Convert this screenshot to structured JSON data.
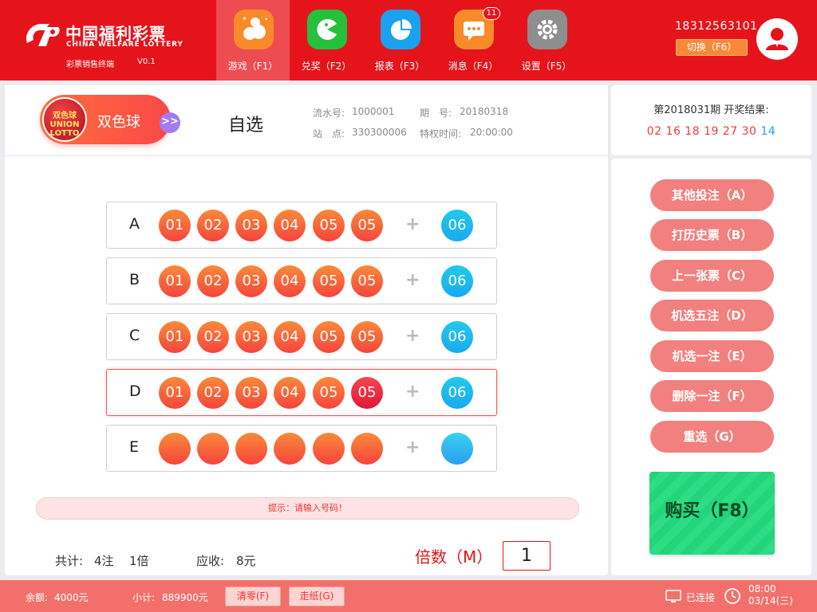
{
  "header": {
    "logo_cn": "中国福利彩票",
    "logo_en": "CHINA WELFARE LOTTERY",
    "subtitle": "彩票销售终端",
    "version": "V0.1",
    "nav": [
      {
        "label": "游戏（F1）",
        "icon": "game-icon",
        "color": "#f88a2a"
      },
      {
        "label": "兑奖（F2）",
        "icon": "prize-icon",
        "color": "#25c03c"
      },
      {
        "label": "报表（F3）",
        "icon": "report-icon",
        "color": "#1aa2ef"
      },
      {
        "label": "消息（F4）",
        "icon": "message-icon",
        "color": "#f88a2a",
        "badge": "11"
      },
      {
        "label": "设置（F5）",
        "icon": "settings-icon",
        "color": "#8e8e8e"
      }
    ],
    "user_phone": "18312563101",
    "switch_label": "切换（F6）"
  },
  "game": {
    "name": "双色球",
    "logo_text": "双色球 UNION LOTTO",
    "arrow": ">>",
    "mode": "自选",
    "serial_label": "流水号:",
    "serial_value": "1000001",
    "period_label": "期　号:",
    "period_value": "20180318",
    "station_label": "站　点:",
    "station_value": "330300006",
    "priv_label": "特权时间:",
    "priv_value": "20:00:00"
  },
  "rows": [
    {
      "letter": "A",
      "red": [
        "01",
        "02",
        "03",
        "04",
        "05",
        "05"
      ],
      "blue": "06"
    },
    {
      "letter": "B",
      "red": [
        "01",
        "02",
        "03",
        "04",
        "05",
        "05"
      ],
      "blue": "06"
    },
    {
      "letter": "C",
      "red": [
        "01",
        "02",
        "03",
        "04",
        "05",
        "05"
      ],
      "blue": "06"
    },
    {
      "letter": "D",
      "red": [
        "01",
        "02",
        "03",
        "04",
        "05",
        "05"
      ],
      "blue": "06"
    },
    {
      "letter": "E",
      "red": [
        "",
        "",
        "",
        "",
        "",
        ""
      ],
      "blue": ""
    }
  ],
  "plus": "+",
  "tip": "提示：请输入号码！",
  "summary": {
    "total_label": "共计:",
    "count": "4注",
    "multiple": "1倍",
    "due_label": "应收:",
    "due_value": "8元",
    "mult_label": "倍数（M）",
    "mult_value": "1"
  },
  "draw": {
    "title": "第2018031期 开奖结果:",
    "red": "02 16 18 19 27 30",
    "blue": "14"
  },
  "side_buttons": [
    "其他投注（A）",
    "打历史票（B）",
    "上一张票（C）",
    "机选五注（D）",
    "机选一注（E）",
    "删除一注（F）",
    "重选（G）"
  ],
  "buy_label": "购买（F8）",
  "footer": {
    "balance_label": "余额:",
    "balance_value": "4000元",
    "subtotal_label": "小计:",
    "subtotal_value": "889900元",
    "clear_label": "清零(F)",
    "paper_label": "走纸(G)",
    "status": "已连接",
    "time": "08:00",
    "date": "03/14(三)"
  }
}
